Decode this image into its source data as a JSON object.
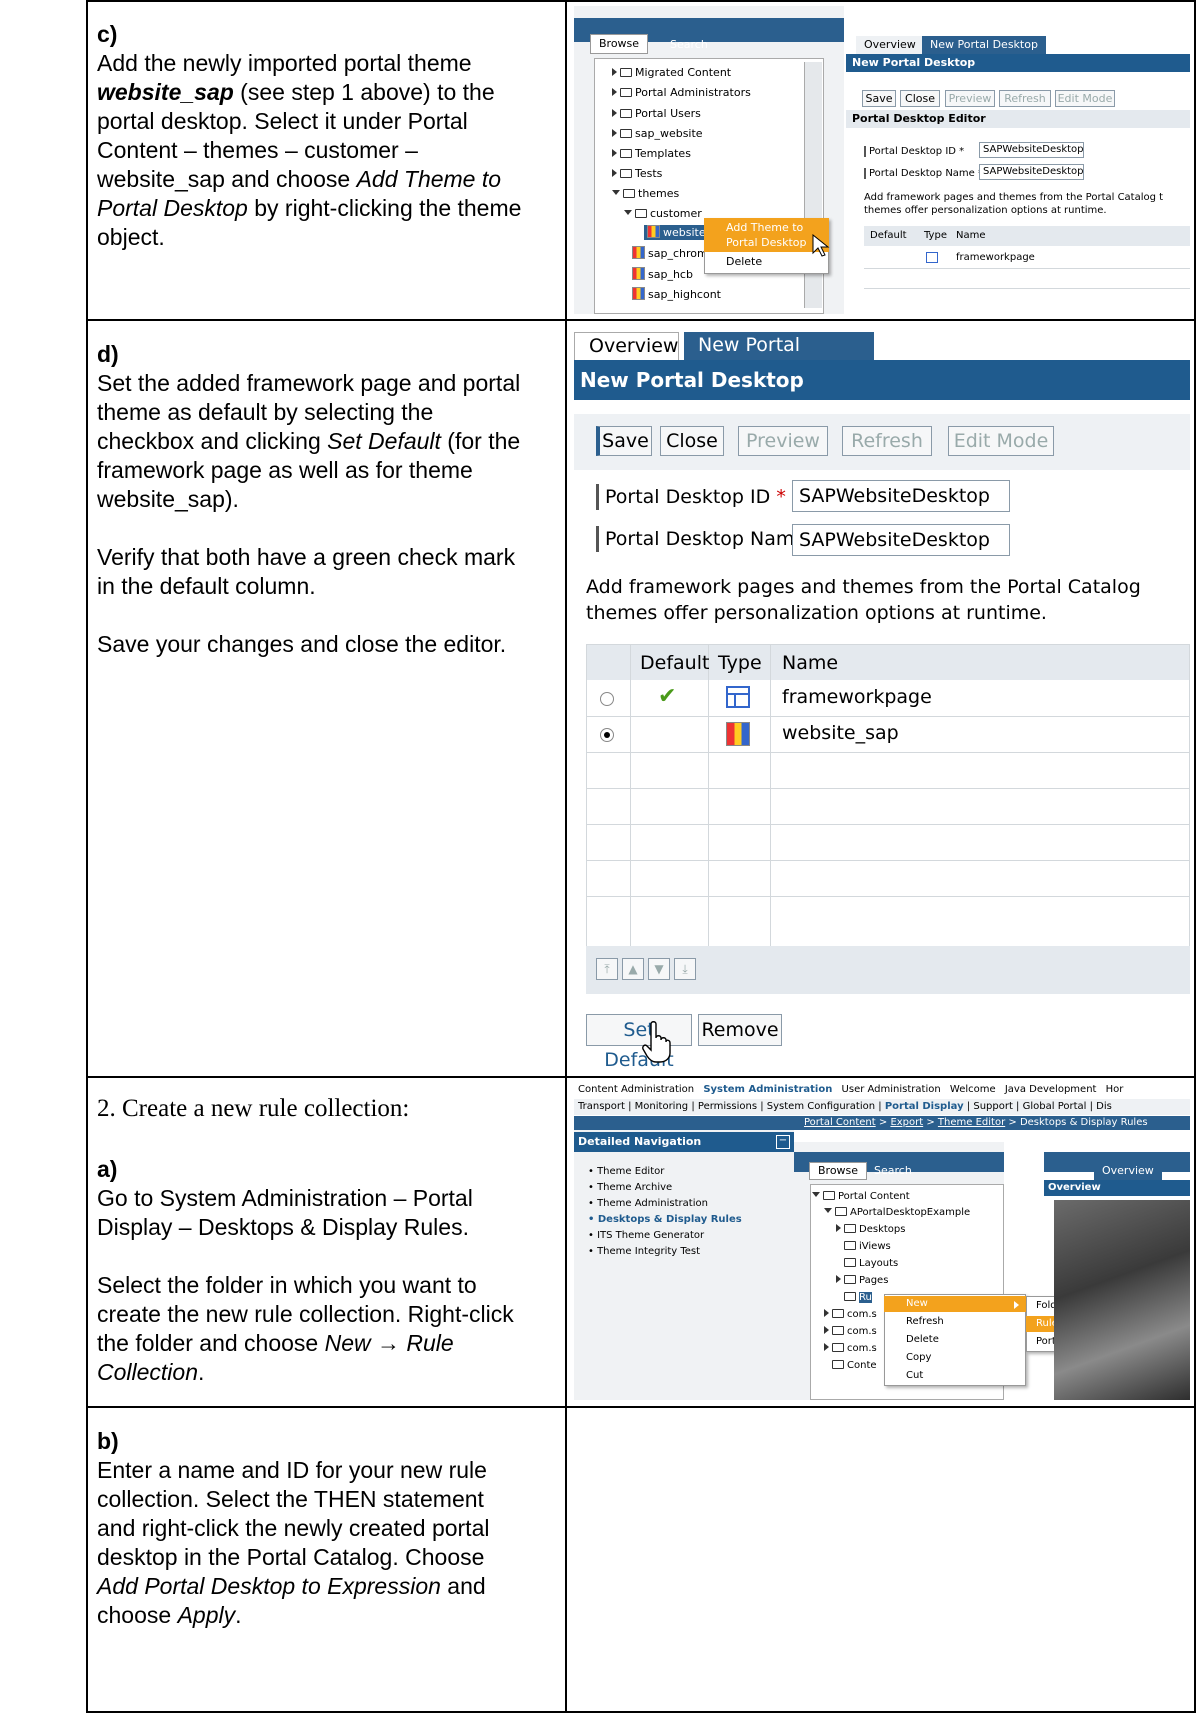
{
  "steps": {
    "c": {
      "letter": "c)",
      "text_1": "Add the newly imported portal theme ",
      "text_bold": "website_sap",
      "text_2": " (see step 1 above) to the portal desktop. Select it under Portal Content – themes – customer – website_sap and choose ",
      "text_italic": "Add Theme to Portal Desktop",
      "text_3": " by right-clicking the theme object."
    },
    "d": {
      "letter": "d)",
      "para1_a": "Set the added framework page and portal theme as default by selecting the checkbox and clicking ",
      "para1_italic": "Set Default",
      "para1_b": " (for the framework page as well as for theme website_sap).",
      "para2": "Verify that both have a green check mark in the default column.",
      "para3": "Save your changes and close the editor."
    },
    "two": {
      "number": "2.",
      "text": "Create a new rule collection:"
    },
    "a": {
      "letter": "a)",
      "para1": "Go to System Administration – Portal Display – Desktops & Display Rules.",
      "para2_a": "Select the folder in which you want to create the new rule collection. Right-click the folder and choose ",
      "para2_italic": "New → Rule Collection",
      "para2_b": "."
    },
    "b": {
      "letter": "b)",
      "text_a": "Enter a name and ID for your new rule collection. Select the THEN statement and right-click the newly created portal desktop in the Portal Catalog. Choose ",
      "text_italic1": "Add Portal Desktop to Expression",
      "text_b": " and choose ",
      "text_italic2": "Apply",
      "text_c": "."
    }
  },
  "shot1": {
    "tabs": [
      "Browse",
      "Search"
    ],
    "right_tabs": [
      "Overview",
      "New Portal Desktop"
    ],
    "title": "New Portal Desktop",
    "buttons": [
      "Save",
      "Close",
      "Preview",
      "Refresh",
      "Edit Mode"
    ],
    "editor_title": "Portal Desktop Editor",
    "id_label": "Portal Desktop ID *",
    "id_value": "SAPWebsiteDesktop",
    "name_label": "Portal Desktop Name *",
    "name_value": "SAPWebsiteDesktop",
    "hint_1": "Add framework pages and themes from the Portal Catalog t",
    "hint_2": "themes offer personalization options at runtime.",
    "col_default": "Default",
    "col_type": "Type",
    "col_name": "Name",
    "row_name": "frameworkpage",
    "tree": [
      "Migrated Content",
      "Portal Administrators",
      "Portal Users",
      "sap_website",
      "Templates",
      "Tests",
      "themes",
      "customer",
      "website_sap",
      "sap_chrome",
      "sap_hcb",
      "sap_highcont"
    ],
    "menu": [
      "Add Theme to",
      "Portal Desktop",
      "Delete"
    ]
  },
  "shot2": {
    "tabs": [
      "Overview",
      "New Portal Desktop"
    ],
    "title": "New Portal Desktop",
    "buttons": [
      "Save",
      "Close",
      "Preview",
      "Refresh",
      "Edit Mode"
    ],
    "id_label": "Portal Desktop ID",
    "id_value": "SAPWebsiteDesktop",
    "name_label": "Portal Desktop Name",
    "name_value": "SAPWebsiteDesktop",
    "required_mark": "*",
    "hint_1": "Add framework pages and themes from the Portal Catalog",
    "hint_2": "themes offer personalization options at runtime.",
    "col_default": "Default",
    "col_type": "Type",
    "col_name": "Name",
    "rows": [
      {
        "name": "frameworkpage",
        "default": "✔",
        "selected": false
      },
      {
        "name": "website_sap",
        "default": "",
        "selected": true
      }
    ],
    "set_default": "Set Default",
    "remove": "Remove"
  },
  "shot3": {
    "top_tabs": [
      "Content Administration",
      "System Administration",
      "User Administration",
      "Welcome",
      "Java Development",
      "Hor"
    ],
    "sub_tabs": [
      "Transport",
      "Monitoring",
      "Permissions",
      "System Configuration",
      "Portal Display",
      "Support",
      "Global Portal",
      "Dis"
    ],
    "breadcrumb": [
      "Portal Content",
      "Export",
      "Theme Editor",
      "Desktops & Display Rules"
    ],
    "nav_title": "Detailed Navigation",
    "nav_items": [
      "Theme Editor",
      "Theme Archive",
      "Theme Administration",
      "Desktops & Display Rules",
      "ITS Theme Generator",
      "Theme Integrity Test"
    ],
    "browse_tabs": [
      "Browse",
      "Search"
    ],
    "overview_tab": "Overview",
    "overview_title": "Overview",
    "tree": [
      "Portal Content",
      "APortalDesktopExample",
      "Desktops",
      "iViews",
      "Layouts",
      "Pages",
      "Ru",
      "com.s",
      "com.s",
      "com.s",
      "Conte"
    ],
    "menu": [
      "New",
      "Refresh",
      "Delete",
      "Copy",
      "Cut"
    ],
    "submenu": [
      "Folder",
      "Rule Collection",
      "Portal Desktop"
    ]
  }
}
